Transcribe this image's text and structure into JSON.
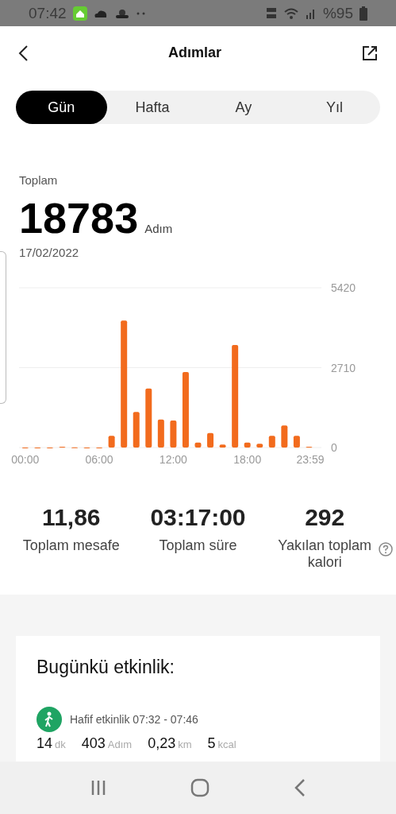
{
  "status_bar": {
    "time": "07:42",
    "battery": "%95"
  },
  "header": {
    "title": "Adımlar"
  },
  "tabs": [
    {
      "label": "Gün",
      "selected": true
    },
    {
      "label": "Hafta",
      "selected": false
    },
    {
      "label": "Ay",
      "selected": false
    },
    {
      "label": "Yıl",
      "selected": false
    }
  ],
  "summary": {
    "label": "Toplam",
    "value": "18783",
    "unit": "Adım",
    "date": "17/02/2022"
  },
  "chart_data": {
    "type": "bar",
    "x": [
      0,
      1,
      2,
      3,
      4,
      5,
      6,
      7,
      8,
      9,
      10,
      11,
      12,
      13,
      14,
      15,
      16,
      17,
      18,
      19,
      20,
      21,
      22,
      23
    ],
    "series": [
      {
        "color": "#f26b1d",
        "values": [
          0,
          0,
          0,
          30,
          10,
          0,
          0,
          400,
          4310,
          1210,
          2000,
          950,
          920,
          2560,
          170,
          490,
          100,
          3480,
          170,
          130,
          400,
          750,
          400,
          30
        ]
      }
    ],
    "xlim": [
      -0.5,
      24
    ],
    "ylim": [
      0,
      5420
    ],
    "yticks": [
      0,
      2710,
      5420
    ],
    "xticks": [
      {
        "value": 0,
        "label": "00:00"
      },
      {
        "value": 6,
        "label": "06:00"
      },
      {
        "value": 12,
        "label": "12:00"
      },
      {
        "value": 18,
        "label": "18:00"
      },
      {
        "value": 23.98,
        "label": "23:59"
      }
    ]
  },
  "stats": [
    {
      "value": "11,86",
      "label": "Toplam mesafe",
      "info": false
    },
    {
      "value": "03:17:00",
      "label": "Toplam süre",
      "info": false
    },
    {
      "value": "292",
      "label": "Yakılan toplam kalori",
      "info": true
    }
  ],
  "activity": {
    "title": "Bugünkü etkinlik:",
    "items": [
      {
        "name": "Hafif etkinlik 07:32 - 07:46",
        "metrics": [
          {
            "value": "14",
            "unit": "dk"
          },
          {
            "value": "403",
            "unit": "Adım"
          },
          {
            "value": "0,23",
            "unit": "km"
          },
          {
            "value": "5",
            "unit": "kcal"
          }
        ]
      }
    ]
  }
}
